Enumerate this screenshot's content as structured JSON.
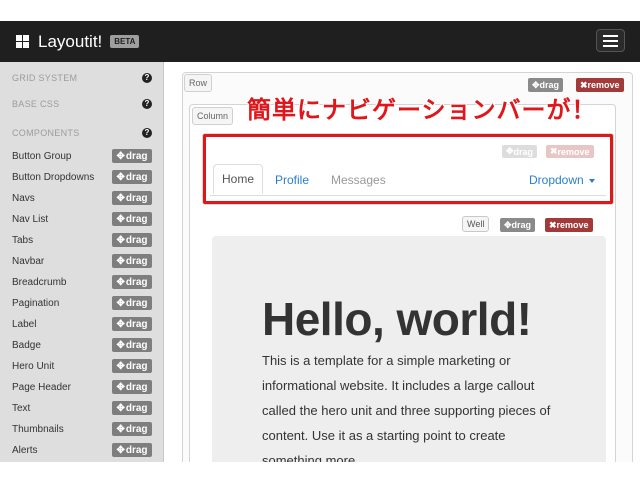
{
  "app": {
    "name": "Layoutit!",
    "badge": "BETA"
  },
  "sidebar": {
    "sections": [
      {
        "label": "GRID SYSTEM",
        "help": "?"
      },
      {
        "label": "BASE CSS",
        "help": "?"
      },
      {
        "label": "COMPONENTS",
        "help": "?"
      }
    ],
    "drag_label": "drag",
    "items": [
      {
        "label": "Button Group"
      },
      {
        "label": "Button Dropdowns"
      },
      {
        "label": "Navs"
      },
      {
        "label": "Nav List"
      },
      {
        "label": "Tabs"
      },
      {
        "label": "Navbar"
      },
      {
        "label": "Breadcrumb"
      },
      {
        "label": "Pagination"
      },
      {
        "label": "Label"
      },
      {
        "label": "Badge"
      },
      {
        "label": "Hero Unit"
      },
      {
        "label": "Page Header"
      },
      {
        "label": "Text"
      },
      {
        "label": "Thumbnails"
      },
      {
        "label": "Alerts"
      }
    ]
  },
  "canvas": {
    "row_tag": "Row",
    "column_tag": "Column",
    "drag_label": "drag",
    "remove_label": "remove",
    "annotation": "簡単にナビゲーションバーが！",
    "nav": {
      "tabs": [
        {
          "label": "Home"
        },
        {
          "label": "Profile"
        },
        {
          "label": "Messages"
        }
      ],
      "dropdown": "Dropdown"
    },
    "well_tag": "Well",
    "hero": {
      "title": "Hello, world!",
      "text": "This is a template for a simple marketing or informational website. It includes a large callout called the hero unit and three supporting pieces of content. Use it as a starting point to create something more"
    }
  },
  "colors": {
    "navbar": "#1f1f1f",
    "sidebar": "#dedede",
    "annotation_red": "#e0161b",
    "remove_red": "#a33a3a",
    "link_blue": "#2a7fc9"
  }
}
